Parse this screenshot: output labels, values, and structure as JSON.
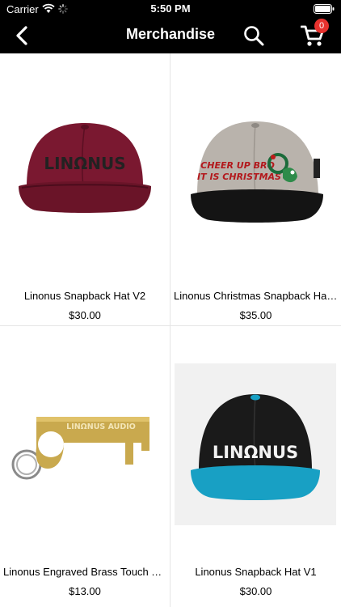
{
  "status_bar": {
    "carrier": "Carrier",
    "time": "5:50 PM"
  },
  "nav": {
    "title": "Merchandise",
    "cart_count": "0"
  },
  "products": [
    {
      "name": "Linonus Snapback Hat V2",
      "price": "$30.00",
      "image": "maroon-snapback-hat"
    },
    {
      "name": "Linonus Christmas Snapback Hat…",
      "price": "$35.00",
      "image": "grey-christmas-snapback-hat",
      "print_line1": "CHEER UP BRO",
      "print_line2": "IT IS CHRISTMAS"
    },
    {
      "name": "Linonus Engraved Brass Touch Tool",
      "price": "$13.00",
      "image": "brass-touch-tool-keychain",
      "engraving": "LINΩNUS AUDIO"
    },
    {
      "name": "Linonus Snapback Hat V1",
      "price": "$30.00",
      "image": "black-teal-snapback-hat"
    }
  ],
  "brand_mark": "LINΩNUS",
  "colors": {
    "header_bg": "#000000",
    "badge": "#e8322e",
    "divider": "#e5e5e5"
  }
}
